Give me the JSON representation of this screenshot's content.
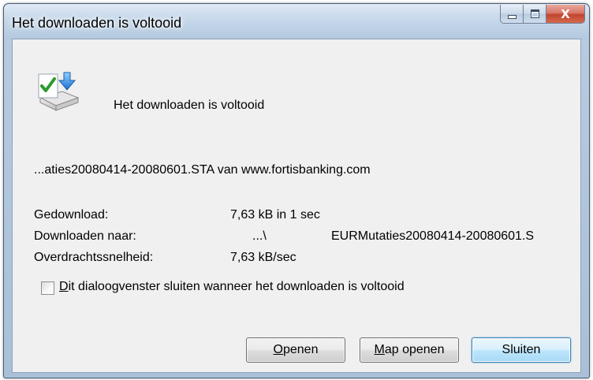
{
  "window": {
    "title": "Het downloaden is voltooid",
    "minimize_glyph": "",
    "maximize_glyph": "",
    "close_glyph": "X"
  },
  "header": {
    "icon": "download-complete-icon",
    "message": "Het downloaden is voltooid"
  },
  "source": {
    "text": "...aties20080414-20080601.STA van www.fortisbanking.com"
  },
  "details": {
    "downloaded_label": "Gedownload:",
    "downloaded_value": "7,63 kB in 1 sec",
    "destination_label": "Downloaden naar:",
    "destination_path": "...\\",
    "destination_file": "EURMutaties20080414-20080601.S",
    "speed_label": "Overdrachtssnelheid:",
    "speed_value": "7,63 kB/sec"
  },
  "options": {
    "close_checkbox_first": "D",
    "close_checkbox_rest": "it dialoogvenster sluiten wanneer het downloaden is voltooid",
    "close_checkbox_checked": false
  },
  "buttons": {
    "open_first": "O",
    "open_rest": "penen",
    "open_folder_first": "M",
    "open_folder_rest": "ap openen",
    "close_label": "Sluiten"
  },
  "colors": {
    "close_button": "#c2452f",
    "default_button": "#3c7fb1",
    "dialog_background": "#f0f0f0"
  }
}
